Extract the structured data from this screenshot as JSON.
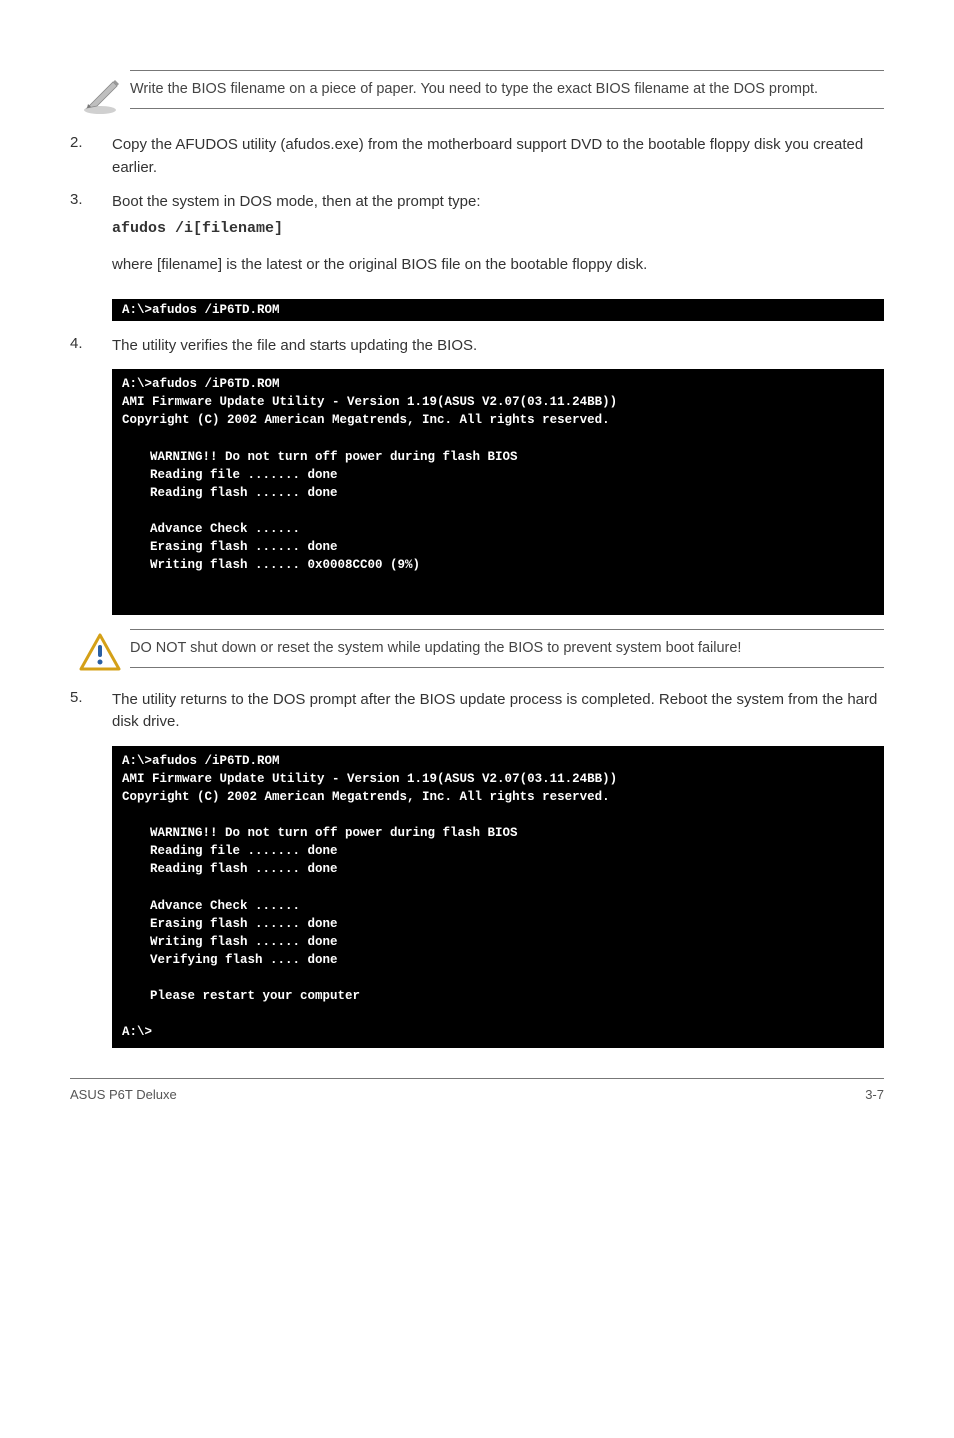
{
  "note": {
    "text": "Write the BIOS filename on a piece of paper. You need to type the exact BIOS filename at the DOS prompt."
  },
  "steps": {
    "s2": {
      "num": "2.",
      "text": "Copy the AFUDOS utility (afudos.exe) from the motherboard support DVD to the bootable floppy disk you created earlier."
    },
    "s3": {
      "num": "3.",
      "text": "Boot the system in DOS mode, then at the prompt type:",
      "cmd": "afudos /i[filename]",
      "after": "where [filename] is the latest or the original BIOS file on the bootable floppy disk."
    },
    "s4": {
      "num": "4.",
      "text": "The utility verifies the file and starts updating the BIOS."
    },
    "s5": {
      "num": "5.",
      "text": "The utility returns to the DOS prompt after the BIOS update process is completed. Reboot the system from the hard disk drive."
    }
  },
  "terminals": {
    "t1": "A:\\>afudos /iP6TD.ROM",
    "t2": {
      "l1": "A:\\>afudos /iP6TD.ROM",
      "l2": "AMI Firmware Update Utility - Version 1.19(ASUS V2.07(03.11.24BB))",
      "l3": "Copyright (C) 2002 American Megatrends, Inc. All rights reserved.",
      "l4": "WARNING!! Do not turn off power during flash BIOS",
      "l5": "Reading file ....... done",
      "l6": "Reading flash ...... done",
      "l7": "Advance Check ......",
      "l8": "Erasing flash ...... done",
      "l9": "Writing flash ...... 0x0008CC00 (9%)"
    },
    "t3": {
      "l1": "A:\\>afudos /iP6TD.ROM",
      "l2": "AMI Firmware Update Utility - Version 1.19(ASUS V2.07(03.11.24BB))",
      "l3": "Copyright (C) 2002 American Megatrends, Inc. All rights reserved.",
      "l4": "WARNING!! Do not turn off power during flash BIOS",
      "l5": "Reading file ....... done",
      "l6": "Reading flash ...... done",
      "l7": "Advance Check ......",
      "l8": "Erasing flash ...... done",
      "l9": "Writing flash ...... done",
      "l10": "Verifying flash .... done",
      "l11": "Please restart your computer",
      "l12": "A:\\>"
    }
  },
  "warning": {
    "text": "DO NOT shut down or reset the system while updating the BIOS to prevent system boot failure!"
  },
  "footer": {
    "left": "ASUS P6T Deluxe",
    "right": "3-7"
  }
}
